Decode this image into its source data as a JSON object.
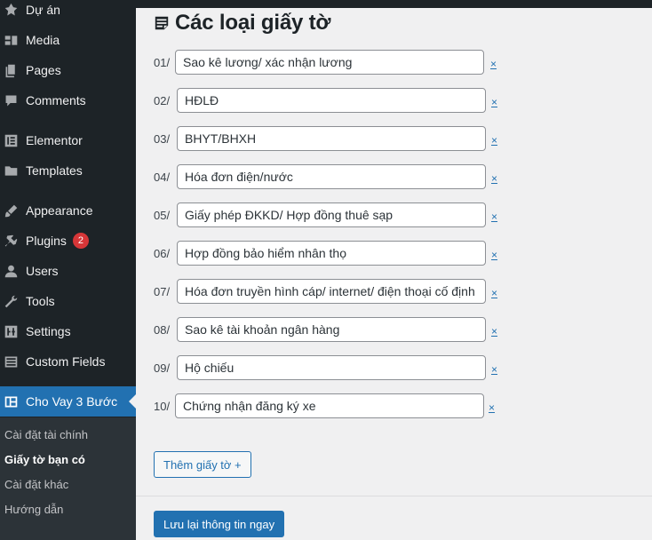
{
  "sidebar": {
    "items": [
      {
        "label": "Dự án",
        "icon": "pin-icon"
      },
      {
        "label": "Media",
        "icon": "media-icon"
      },
      {
        "label": "Pages",
        "icon": "pages-icon"
      },
      {
        "label": "Comments",
        "icon": "comments-icon"
      },
      {
        "label": "Elementor",
        "icon": "elementor-icon"
      },
      {
        "label": "Templates",
        "icon": "folder-icon"
      },
      {
        "label": "Appearance",
        "icon": "brush-icon"
      },
      {
        "label": "Plugins",
        "icon": "plugin-icon",
        "badge": "2"
      },
      {
        "label": "Users",
        "icon": "user-icon"
      },
      {
        "label": "Tools",
        "icon": "wrench-icon"
      },
      {
        "label": "Settings",
        "icon": "settings-icon"
      },
      {
        "label": "Custom Fields",
        "icon": "fields-icon"
      },
      {
        "label": "Cho Vay 3 Bước",
        "icon": "table-icon",
        "active": true
      }
    ],
    "submenu": [
      {
        "label": "Cài đặt tài chính"
      },
      {
        "label": "Giấy tờ bạn có",
        "current": true
      },
      {
        "label": "Cài đặt khác"
      },
      {
        "label": "Hướng dẫn"
      }
    ]
  },
  "main": {
    "title": "Các loại giấy tờ",
    "remove_label": "×",
    "documents": [
      {
        "num": "01/",
        "value": "Sao kê lương/ xác nhận lương"
      },
      {
        "num": "02/",
        "value": "HĐLĐ"
      },
      {
        "num": "03/",
        "value": "BHYT/BHXH"
      },
      {
        "num": "04/",
        "value": "Hóa đơn điện/nước"
      },
      {
        "num": "05/",
        "value": "Giấy phép ĐKKD/ Hợp đồng thuê sạp"
      },
      {
        "num": "06/",
        "value": "Hợp đồng bảo hiểm nhân thọ"
      },
      {
        "num": "07/",
        "value": "Hóa đơn truyền hình cáp/ internet/ điện thoại cố định"
      },
      {
        "num": "08/",
        "value": "Sao kê tài khoản ngân hàng"
      },
      {
        "num": "09/",
        "value": "Hộ chiếu"
      },
      {
        "num": "10/",
        "value": "Chứng nhận đăng ký xe"
      }
    ],
    "add_label": "Thêm giấy tờ +",
    "save_label": "Lưu lại thông tin ngay"
  },
  "colors": {
    "sidebar_bg": "#1d2327",
    "accent": "#2271b1",
    "badge": "#d63638"
  }
}
